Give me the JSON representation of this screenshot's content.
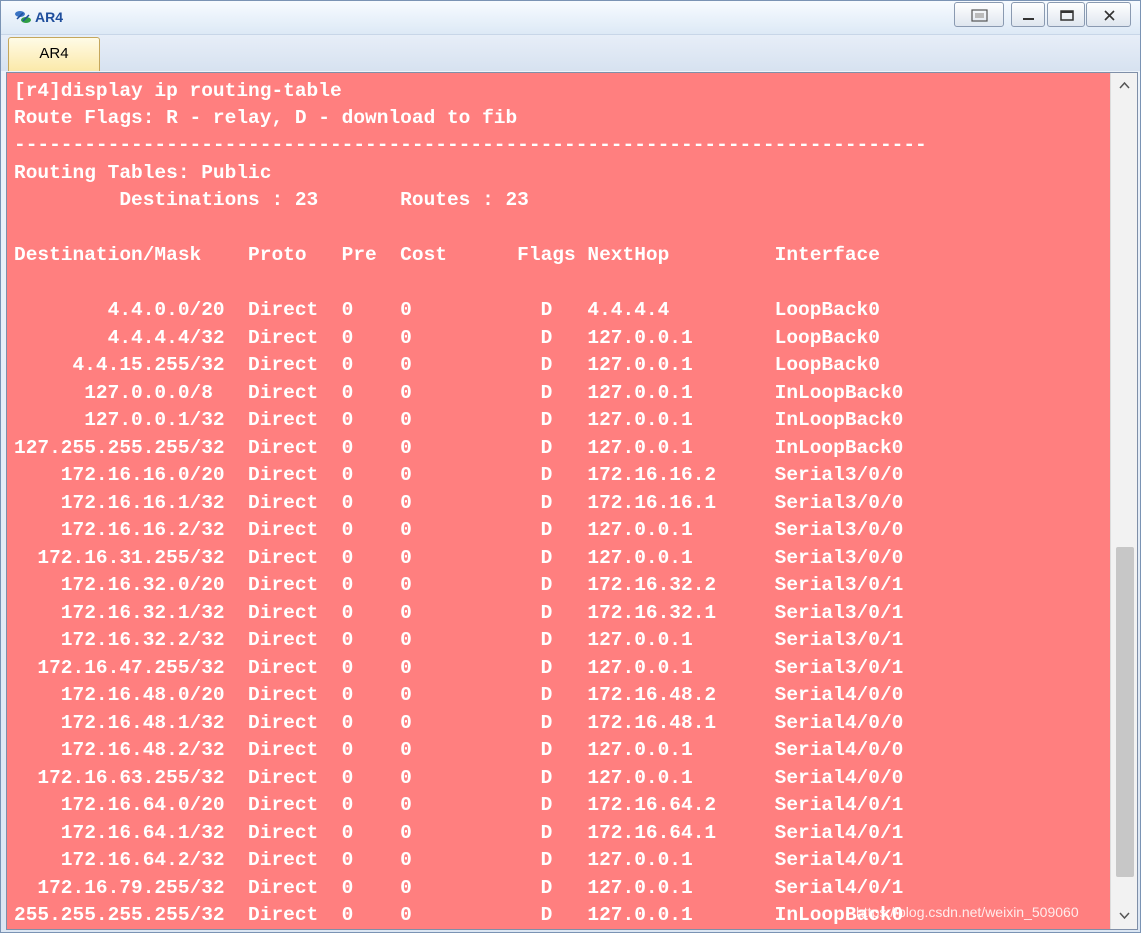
{
  "window": {
    "title": "AR4",
    "tab_label": "AR4",
    "accent_color": "#1f4e9c",
    "terminal_bg": "#ff7f7f",
    "terminal_fg": "#ffffff"
  },
  "icons": {
    "app": "router-icon",
    "restore": "restore-icon",
    "minimize": "minimize-icon",
    "maximize": "maximize-icon",
    "close": "close-icon",
    "scroll_up": "chevron-up-icon",
    "scroll_down": "chevron-down-icon"
  },
  "terminal": {
    "command": "[r4]display ip routing-table",
    "flags_legend": "Route Flags: R - relay, D - download to fib",
    "separator": "------------------------------------------------------------------------------",
    "table_name": "Routing Tables: Public",
    "counts_line": "         Destinations : 23       Routes : 23",
    "header": "Destination/Mask    Proto   Pre  Cost      Flags NextHop         Interface",
    "routes": [
      "        4.4.0.0/20  Direct  0    0           D   4.4.4.4         LoopBack0",
      "        4.4.4.4/32  Direct  0    0           D   127.0.0.1       LoopBack0",
      "     4.4.15.255/32  Direct  0    0           D   127.0.0.1       LoopBack0",
      "      127.0.0.0/8   Direct  0    0           D   127.0.0.1       InLoopBack0",
      "      127.0.0.1/32  Direct  0    0           D   127.0.0.1       InLoopBack0",
      "127.255.255.255/32  Direct  0    0           D   127.0.0.1       InLoopBack0",
      "    172.16.16.0/20  Direct  0    0           D   172.16.16.2     Serial3/0/0",
      "    172.16.16.1/32  Direct  0    0           D   172.16.16.1     Serial3/0/0",
      "    172.16.16.2/32  Direct  0    0           D   127.0.0.1       Serial3/0/0",
      "  172.16.31.255/32  Direct  0    0           D   127.0.0.1       Serial3/0/0",
      "    172.16.32.0/20  Direct  0    0           D   172.16.32.2     Serial3/0/1",
      "    172.16.32.1/32  Direct  0    0           D   172.16.32.1     Serial3/0/1",
      "    172.16.32.2/32  Direct  0    0           D   127.0.0.1       Serial3/0/1",
      "  172.16.47.255/32  Direct  0    0           D   127.0.0.1       Serial3/0/1",
      "    172.16.48.0/20  Direct  0    0           D   172.16.48.2     Serial4/0/0",
      "    172.16.48.1/32  Direct  0    0           D   172.16.48.1     Serial4/0/0",
      "    172.16.48.2/32  Direct  0    0           D   127.0.0.1       Serial4/0/0",
      "  172.16.63.255/32  Direct  0    0           D   127.0.0.1       Serial4/0/0",
      "    172.16.64.0/20  Direct  0    0           D   172.16.64.2     Serial4/0/1",
      "    172.16.64.1/32  Direct  0    0           D   172.16.64.1     Serial4/0/1",
      "    172.16.64.2/32  Direct  0    0           D   127.0.0.1       Serial4/0/1",
      "  172.16.79.255/32  Direct  0    0           D   127.0.0.1       Serial4/0/1",
      "255.255.255.255/32  Direct  0    0           D   127.0.0.1       InLoopBack0"
    ]
  },
  "watermark": "https://blog.csdn.net/weixin_509060"
}
